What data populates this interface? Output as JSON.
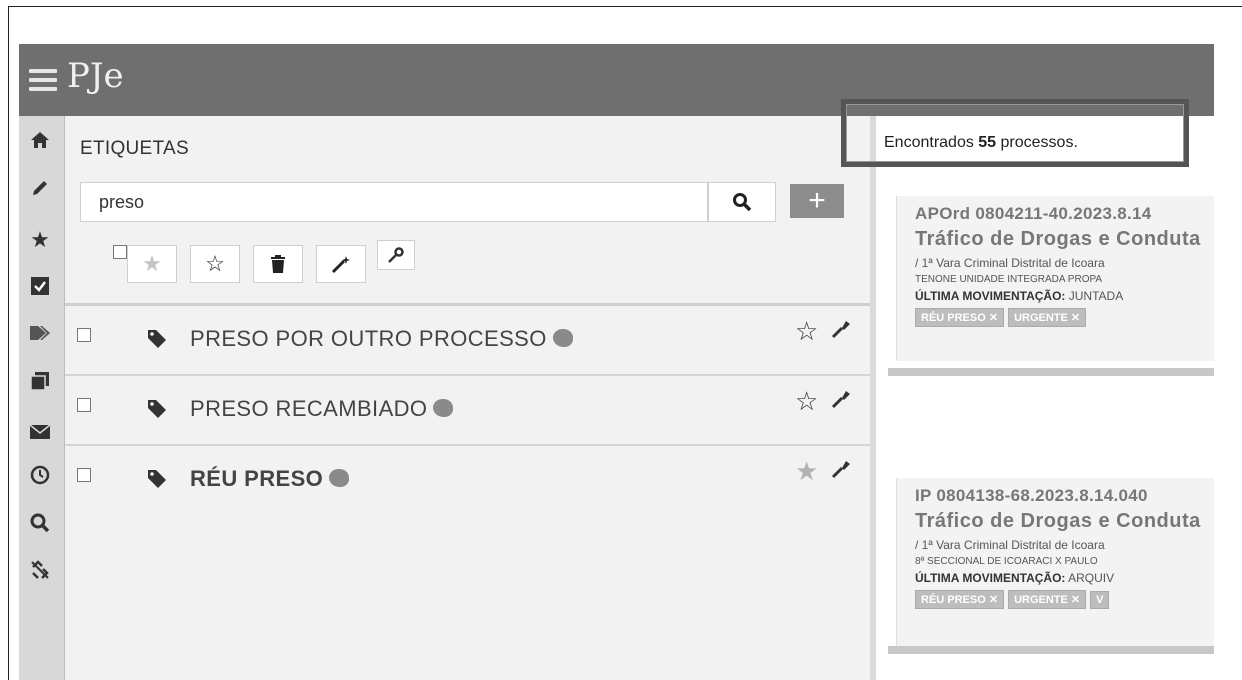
{
  "app": {
    "brand": "PJe"
  },
  "rail": {
    "icons": [
      "home-icon",
      "pencil-icon",
      "star-icon",
      "checkbox-icon",
      "tags-icon",
      "copy-icon",
      "envelope-icon",
      "history-icon",
      "search-icon",
      "unlink-icon"
    ]
  },
  "tags_panel": {
    "title": "ETIQUETAS",
    "search": {
      "value": "preso",
      "placeholder": ""
    },
    "add_label": "+",
    "items": [
      {
        "label": "PRESO POR OUTRO PROCESSO",
        "bold": false,
        "starred": false
      },
      {
        "label": "PRESO RECAMBIADO",
        "bold": false,
        "starred": false
      },
      {
        "label": "RÉU PRESO",
        "bold": true,
        "starred": true
      }
    ]
  },
  "results": {
    "found_prefix": "Encontrados ",
    "found_count": "55",
    "found_suffix": " processos.",
    "cards": [
      {
        "number": "APOrd 0804211-40.2023.8.14",
        "subject": "Tráfico de Drogas e Conduta",
        "court": "/ 1ª Vara Criminal Distrital de Icoara",
        "parties": "TENONE UNIDADE INTEGRADA PROPA",
        "movement_label": "ÚLTIMA MOVIMENTAÇÃO:",
        "movement_value": " JUNTADA",
        "badges": [
          "RÉU PRESO ✕",
          "URGENTE ✕"
        ]
      },
      {
        "number": "IP 0804138-68.2023.8.14.040",
        "subject": "Tráfico de Drogas e Conduta",
        "court": "/ 1ª Vara Criminal Distrital de Icoara",
        "parties": "8ª SECCIONAL DE ICOARACI X PAULO",
        "movement_label": "ÚLTIMA MOVIMENTAÇÃO:",
        "movement_value": " ARQUIV",
        "badges": [
          "RÉU PRESO ✕",
          "URGENTE ✕",
          "V"
        ]
      }
    ]
  }
}
